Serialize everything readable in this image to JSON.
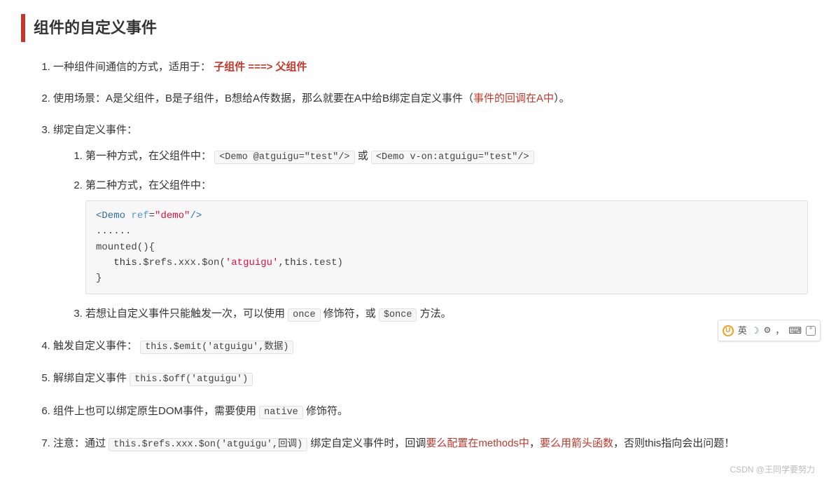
{
  "heading": "组件的自定义事件",
  "items": {
    "i1_prefix": "一种组件间通信的方式，适用于：",
    "i1_red": "子组件 ===> 父组件",
    "i2_prefix": "使用场景：A是父组件，B是子组件，B想给A传数据，那么就要在A中给B绑定自定义事件（",
    "i2_red": "事件的回调在A中",
    "i2_suffix": "）。",
    "i3": "绑定自定义事件：",
    "i3_1_prefix": "第一种方式，在父组件中：",
    "i3_1_code1": "<Demo @atguigu=\"test\"/>",
    "i3_1_mid": " 或 ",
    "i3_1_code2": "<Demo v-on:atguigu=\"test\"/>",
    "i3_2_prefix": "第二种方式，在父组件中：",
    "i3_2_block": "<Demo ref=\"demo\"/>\n......\nmounted(){\n   this.$refs.xxx.$on('atguigu',this.test)\n}",
    "i3_3_prefix": "若想让自定义事件只能触发一次，可以使用 ",
    "i3_3_code1": "once",
    "i3_3_mid": " 修饰符，或 ",
    "i3_3_code2": "$once",
    "i3_3_suffix": " 方法。",
    "i4_prefix": "触发自定义事件：",
    "i4_code": "this.$emit('atguigu',数据)",
    "i5_prefix": "解绑自定义事件 ",
    "i5_code": "this.$off('atguigu')",
    "i6_prefix": "组件上也可以绑定原生DOM事件，需要使用 ",
    "i6_code": "native",
    "i6_suffix": " 修饰符。",
    "i7_prefix": "注意：通过 ",
    "i7_code": "this.$refs.xxx.$on('atguigu',回调)",
    "i7_mid": " 绑定自定义事件时，回调",
    "i7_red1": "要么配置在methods中",
    "i7_sep": "，",
    "i7_red2": "要么用箭头函数",
    "i7_suffix": "，否则this指向会出问题！"
  },
  "widget": {
    "lang": "英"
  },
  "watermark": "CSDN @王同学要努力"
}
